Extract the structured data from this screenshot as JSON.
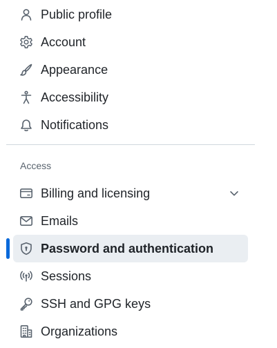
{
  "nav": {
    "items_top": [
      {
        "label": "Public profile",
        "icon": "person-icon"
      },
      {
        "label": "Account",
        "icon": "gear-icon"
      },
      {
        "label": "Appearance",
        "icon": "paintbrush-icon"
      },
      {
        "label": "Accessibility",
        "icon": "accessibility-icon"
      },
      {
        "label": "Notifications",
        "icon": "bell-icon"
      }
    ],
    "section_heading": "Access",
    "items_access": [
      {
        "label": "Billing and licensing",
        "icon": "credit-card-icon",
        "expandable": true
      },
      {
        "label": "Emails",
        "icon": "mail-icon"
      },
      {
        "label": "Password and authentication",
        "icon": "shield-lock-icon",
        "active": true
      },
      {
        "label": "Sessions",
        "icon": "broadcast-icon"
      },
      {
        "label": "SSH and GPG keys",
        "icon": "key-icon"
      },
      {
        "label": "Organizations",
        "icon": "organization-icon"
      }
    ]
  },
  "colors": {
    "active_indicator": "#0969da",
    "active_background": "#eaeef2",
    "text": "#1f2328",
    "muted_text": "#59636e",
    "divider": "#d0d7de"
  }
}
